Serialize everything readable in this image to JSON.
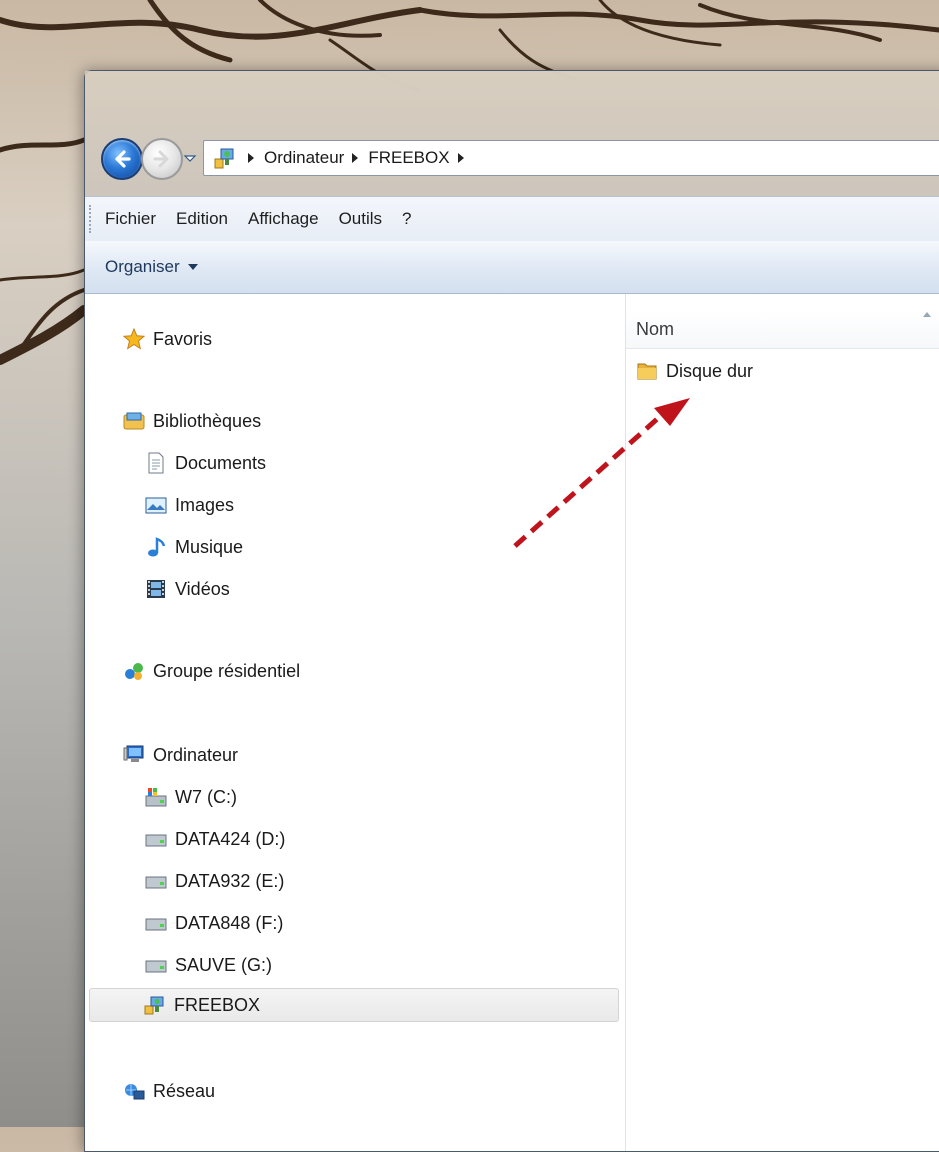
{
  "address_bar": {
    "crumbs": [
      "Ordinateur",
      "FREEBOX"
    ]
  },
  "menu_bar": {
    "items": [
      "Fichier",
      "Edition",
      "Affichage",
      "Outils",
      "?"
    ]
  },
  "command_bar": {
    "organiser_label": "Organiser"
  },
  "nav_pane": {
    "favoris": "Favoris",
    "bibliotheques": "Bibliothèques",
    "libraries": [
      "Documents",
      "Images",
      "Musique",
      "Vidéos"
    ],
    "groupe": "Groupe résidentiel",
    "ordinateur": "Ordinateur",
    "drives": [
      "W7 (C:)",
      "DATA424 (D:)",
      "DATA932 (E:)",
      "DATA848 (F:)",
      "SAUVE (G:)",
      "FREEBOX"
    ],
    "selected_drive": "FREEBOX",
    "reseau": "Réseau"
  },
  "content_pane": {
    "column_name": "Nom",
    "items": [
      "Disque dur"
    ]
  },
  "colors": {
    "annotation_arrow": "#c0141c",
    "selection_bg": "#eeeeee"
  }
}
